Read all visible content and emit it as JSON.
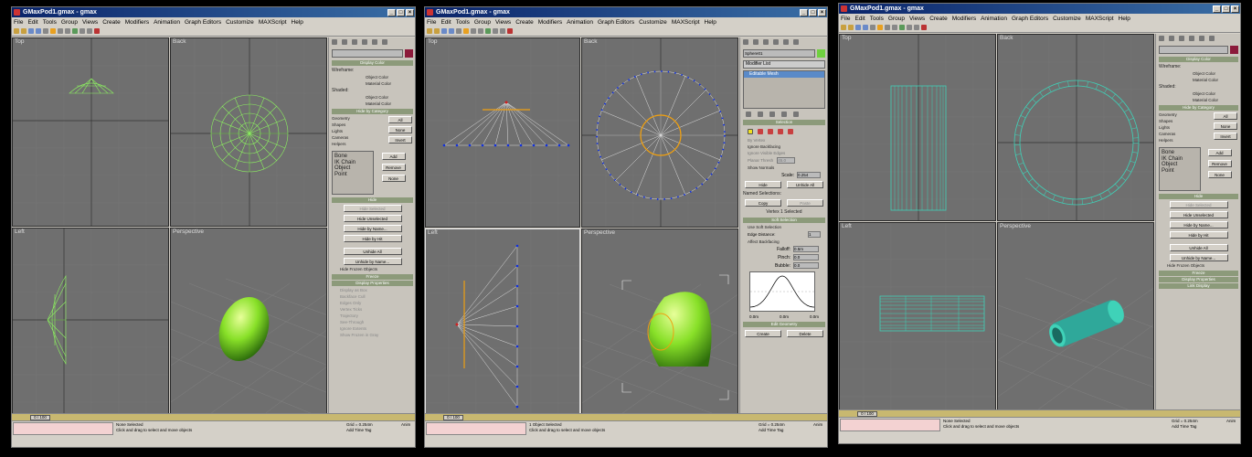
{
  "window_title": "GMaxPod1.gmax - gmax",
  "window_buttons": [
    "_",
    "□",
    "×"
  ],
  "menu": [
    "File",
    "Edit",
    "Tools",
    "Group",
    "Views",
    "Create",
    "Modifiers",
    "Animation",
    "Graph Editors",
    "Customize",
    "MAXScript",
    "Help"
  ],
  "viewport_labels": {
    "top": "Top",
    "back": "Back",
    "left": "Left",
    "perspective": "Perspective"
  },
  "timeline": "0 / 100",
  "status_hint": "Click and drag to select and move objects",
  "add_time_tag": "Add Time Tag",
  "grid": "Grid = 0.254m",
  "anim": "Anim",
  "w1": {
    "sel_status": "None Selected",
    "display_color": "Display Color",
    "wireframe": "Wireframe:",
    "shaded": "Shaded:",
    "object_color": "Object Color",
    "material_color": "Material Color",
    "hide_by_category": "Hide by Category",
    "categories": [
      "Geometry",
      "Shapes",
      "Lights",
      "Cameras",
      "Helpers"
    ],
    "cat_buttons": [
      "All",
      "None",
      "Invert"
    ],
    "list_items": [
      "Bone",
      "IK Chain Object",
      "Point"
    ],
    "add": "Add",
    "remove": "Remove",
    "none": "None",
    "hide": "Hide",
    "hide_buttons": [
      "Hide Selected",
      "Hide Unselected",
      "Hide by Name...",
      "Hide by Hit",
      "Unhide All",
      "Unhide by Name..."
    ],
    "hide_frozen": "Hide Frozen Objects",
    "freeze": "Freeze",
    "display_properties": "Display Properties",
    "dp_items": [
      "Display as Box",
      "Backface Cull",
      "Edges Only",
      "Vertex Ticks",
      "Trajectory",
      "See-Through",
      "Ignore Extents",
      "Show Frozen in Gray"
    ]
  },
  "w2": {
    "sel_status": "1 Object Selected",
    "obj_name": "Sphere01",
    "modifier_list": "Modifier List",
    "stack_item": "Editable Mesh",
    "selection": "Selection",
    "by_vertex": "By Vertex",
    "ignore_backfacing": "Ignore Backfacing",
    "ignore_visible": "Ignore Visible Edges",
    "planar_thresh": "Planar Thresh",
    "planar_val": "45.0",
    "show_normals": "Show Normals",
    "scale": "Scale:",
    "scale_val": "0.254",
    "hide": "Hide",
    "unhide_all": "Unhide All",
    "named_sel": "Named Selections:",
    "copy": "Copy",
    "paste": "Paste",
    "vertex_selected": "Vertex 1 Selected",
    "soft_selection": "Soft Selection",
    "use_soft": "Use Soft Selection",
    "edge_distance": "Edge Distance:",
    "edge_val": "1",
    "affect_back": "Affect Backfacing",
    "falloff": "Falloff:",
    "falloff_val": "0.5m",
    "pinch": "Pinch:",
    "pinch_val": "0.0",
    "bubble": "Bubble:",
    "bubble_val": "0.0",
    "curve_left": "0.0m",
    "curve_mid": "0.0m",
    "curve_right": "0.0m",
    "edit_geometry": "Edit Geometry",
    "create": "Create",
    "delete": "Delete"
  },
  "w3": {
    "sel_status": "None Selected",
    "link_display": "Link Display",
    "hide_buttons": [
      "Hide Selected",
      "Hide Unselected",
      "Hide by Name...",
      "Hide by Hit",
      "Unhide All",
      "Unhide by Name..."
    ],
    "freeze": "Freeze",
    "display_properties": "Display Properties"
  },
  "colors": {
    "title": "#0a246a",
    "viewport": "#6f6f6f",
    "wire_green": "#8cf060",
    "wire_cyan": "#3fd2b8",
    "vertex": "#1030e0",
    "select": "#f0a010",
    "rollout": "#8c9a7a"
  }
}
